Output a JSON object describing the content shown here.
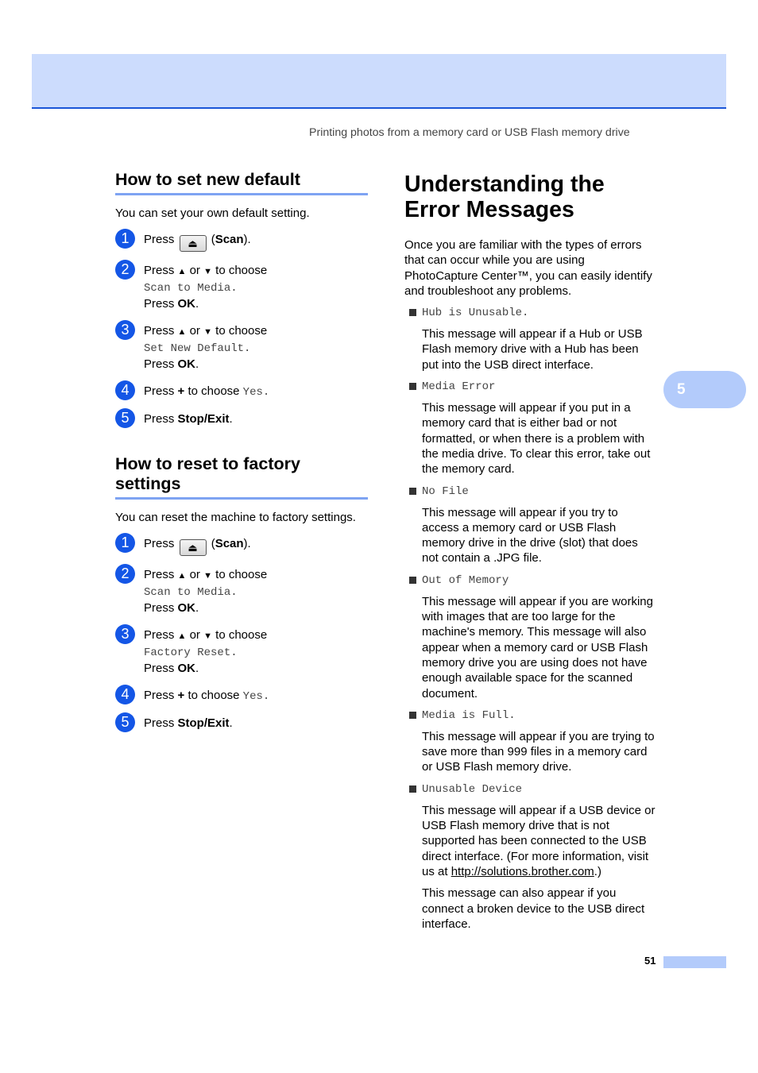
{
  "header": {
    "running_title": "Printing photos from a memory card or USB Flash memory drive",
    "accent_color": "#1a56d8",
    "band_color": "#ccdcfd"
  },
  "left": {
    "sections": [
      {
        "title": "How to set new default",
        "intro": "You can set your own default setting.",
        "steps": [
          {
            "num": "1",
            "pre": "Press",
            "button_icon": "scan-icon",
            "post_open": "(",
            "bold": "Scan",
            "post_close": ")."
          },
          {
            "num": "2",
            "line1_a": "Press",
            "up": "▲",
            "or": "or",
            "down": "▼",
            "line1_b": "to choose",
            "mono": "Scan to Media.",
            "line3_a": "Press",
            "line3_bold": "OK",
            "line3_b": "."
          },
          {
            "num": "3",
            "line1_a": "Press",
            "up": "▲",
            "or": "or",
            "down": "▼",
            "line1_b": "to choose",
            "mono": "Set New Default.",
            "line3_a": "Press",
            "line3_bold": "OK",
            "line3_b": "."
          },
          {
            "num": "4",
            "pre": "Press",
            "bold": "+",
            "mid": "to choose",
            "mono": "Yes."
          },
          {
            "num": "5",
            "pre": "Press",
            "bold": "Stop/Exit",
            "post": "."
          }
        ]
      },
      {
        "title": "How to reset to factory settings",
        "intro": "You can reset the machine to factory settings.",
        "steps": [
          {
            "num": "1",
            "pre": "Press",
            "button_icon": "scan-icon",
            "post_open": "(",
            "bold": "Scan",
            "post_close": ")."
          },
          {
            "num": "2",
            "line1_a": "Press",
            "up": "▲",
            "or": "or",
            "down": "▼",
            "line1_b": "to choose",
            "mono": "Scan to Media.",
            "line3_a": "Press",
            "line3_bold": "OK",
            "line3_b": "."
          },
          {
            "num": "3",
            "line1_a": "Press",
            "up": "▲",
            "or": "or",
            "down": "▼",
            "line1_b": "to choose",
            "mono": "Factory Reset.",
            "line3_a": "Press",
            "line3_bold": "OK",
            "line3_b": "."
          },
          {
            "num": "4",
            "pre": "Press",
            "bold": "+",
            "mid": "to choose",
            "mono": "Yes."
          },
          {
            "num": "5",
            "pre": "Press",
            "bold": "Stop/Exit",
            "post": "."
          }
        ]
      }
    ]
  },
  "right": {
    "title_line1": "Understanding the",
    "title_line2": "Error Messages",
    "intro": "Once you are familiar with the types of errors that can occur while you are using PhotoCapture Center™, you can easily identify and troubleshoot any problems.",
    "errors": [
      {
        "code": "Hub is Unusable.",
        "desc": "This message will appear if a Hub or USB Flash memory drive with a Hub has been put into the USB direct interface."
      },
      {
        "code": "Media Error",
        "desc": "This message will appear if you put in a memory card that is either bad or not formatted, or when there is a problem with the media drive. To clear this error, take out the memory card."
      },
      {
        "code": "No File",
        "desc": "This message will appear if you try to access a memory card or USB Flash memory drive in the drive (slot) that does not contain a .JPG file."
      },
      {
        "code": "Out of Memory",
        "desc": "This message will appear if you are working with images that are too large for the machine's memory. This message will also appear when a memory card or USB Flash memory drive you are using does not have enough available space for the scanned document."
      },
      {
        "code": "Media is Full.",
        "desc": "This message will appear if you are trying to save more than 999 files in a memory card or USB Flash memory drive."
      },
      {
        "code": "Unusable Device",
        "desc_pre": "This message will appear if a USB device or USB Flash memory drive that is not supported has been connected to the USB direct interface. (For more information, visit us at ",
        "link": "http://solutions.brother.com",
        "desc_post": ".)",
        "extra": "This message can also appear if you connect a broken device to the USB direct interface."
      }
    ]
  },
  "chapter_tab": {
    "label": "5"
  },
  "footer": {
    "page_number": "51"
  }
}
